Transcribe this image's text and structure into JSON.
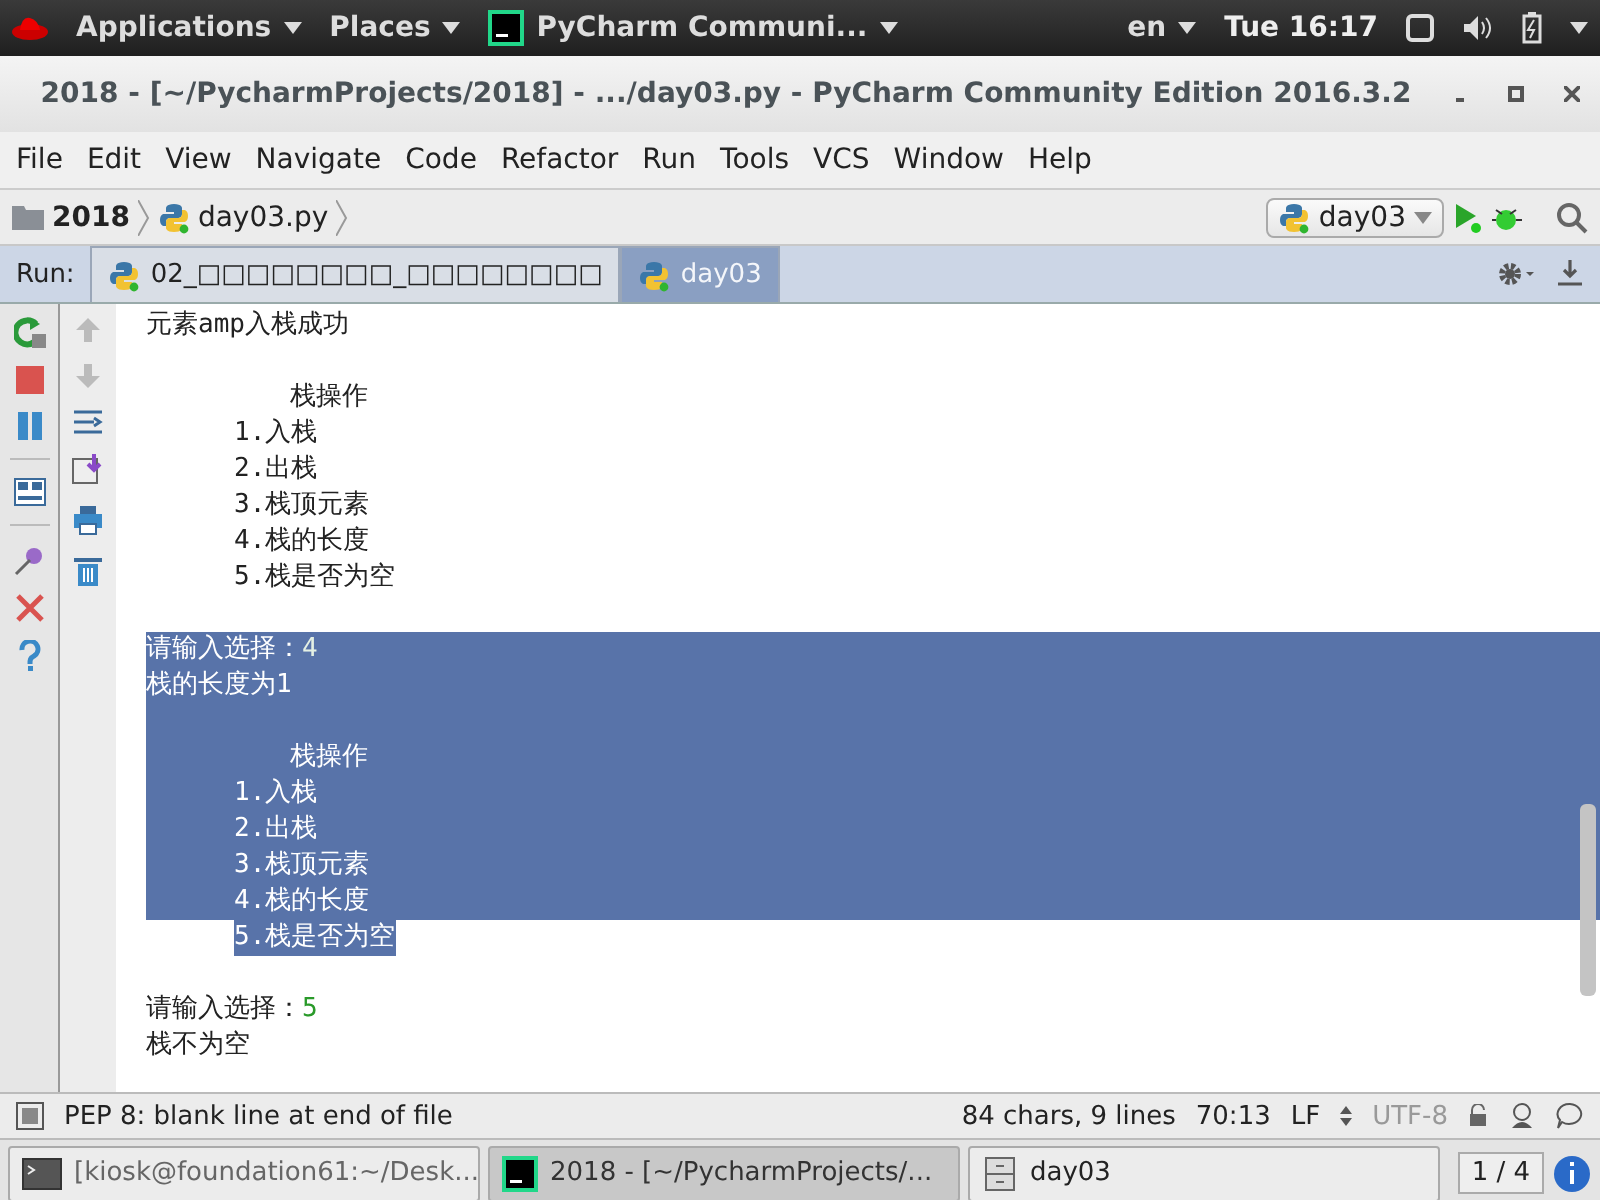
{
  "top_bar": {
    "menus": [
      {
        "label": "Applications"
      },
      {
        "label": "Places"
      }
    ],
    "app": {
      "label": "PyCharm Communi..."
    },
    "language": "en",
    "clock": "Tue 16:17"
  },
  "window": {
    "title": "2018 - [~/PycharmProjects/2018] - .../day03.py - PyCharm Community Edition 2016.3.2"
  },
  "menu_bar": [
    "File",
    "Edit",
    "View",
    "Navigate",
    "Code",
    "Refactor",
    "Run",
    "Tools",
    "VCS",
    "Window",
    "Help"
  ],
  "breadcrumbs": [
    {
      "label": "2018",
      "kind": "folder"
    },
    {
      "label": "day03.py",
      "kind": "file"
    }
  ],
  "run_config": {
    "label": "day03"
  },
  "run_panel": {
    "label": "Run:",
    "tabs": [
      {
        "label": "02_□□□□□□□□_□□□□□□□□",
        "selected": false
      },
      {
        "label": "day03",
        "selected": true
      }
    ]
  },
  "console": [
    {
      "lines": [
        {
          "kind": "plain",
          "text": "元素amp入栈成功",
          "selected": false
        }
      ]
    },
    {
      "lines": [
        {
          "kind": "heading",
          "text": "栈操作",
          "selected": false
        },
        {
          "kind": "item",
          "text": "1.入栈",
          "selected": false
        },
        {
          "kind": "item",
          "text": "2.出栈",
          "selected": false
        },
        {
          "kind": "item",
          "text": "3.栈顶元素",
          "selected": false
        },
        {
          "kind": "item",
          "text": "4.栈的长度",
          "selected": false
        },
        {
          "kind": "item",
          "text": "5.栈是否为空",
          "selected": false
        }
      ]
    },
    {
      "lines": [
        {
          "kind": "plain",
          "text": "请输入选择：",
          "input": "4",
          "selected": true
        },
        {
          "kind": "plain",
          "text": "栈的长度为1",
          "selected": true
        }
      ]
    },
    {
      "lines": [
        {
          "kind": "heading",
          "text": "栈操作",
          "selected": true
        },
        {
          "kind": "item",
          "text": "1.入栈",
          "selected": true
        },
        {
          "kind": "item",
          "text": "2.出栈",
          "selected": true
        },
        {
          "kind": "item",
          "text": "3.栈顶元素",
          "selected": true
        },
        {
          "kind": "item",
          "text": "4.栈的长度",
          "selected": true
        },
        {
          "kind": "item",
          "text": "5.栈是否为空",
          "selected": true
        }
      ]
    },
    {
      "lines": [
        {
          "kind": "plain",
          "text": "请输入选择：",
          "input": "5",
          "selected": false
        },
        {
          "kind": "plain",
          "text": "栈不为空",
          "selected": false
        }
      ]
    }
  ],
  "status_bar": {
    "message": "PEP 8: blank line at end of file",
    "stats": "84 chars, 9 lines",
    "position": "70:13",
    "line_separator": "LF",
    "encoding": "UTF-8"
  },
  "taskbar": {
    "items": [
      {
        "label": "[kiosk@foundation61:~/Desk...",
        "kind": "terminal",
        "selected": false
      },
      {
        "label": "2018 - [~/PycharmProjects/...",
        "kind": "pycharm",
        "selected": true
      },
      {
        "label": "day03",
        "kind": "files",
        "selected": false
      }
    ],
    "workspace": "1 / 4"
  }
}
